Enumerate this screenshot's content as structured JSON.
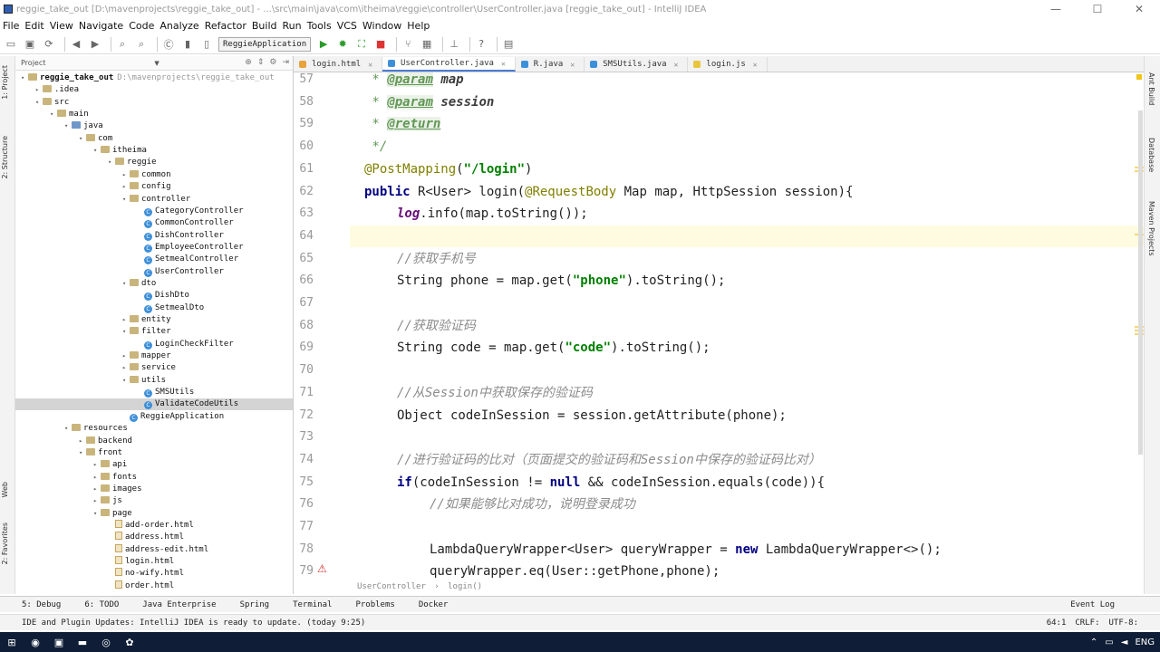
{
  "window": {
    "title": "reggie_take_out [D:\\mavenprojects\\reggie_take_out] - ...\\src\\main\\java\\com\\itheima\\reggie\\controller\\UserController.java [reggie_take_out] - IntelliJ IDEA"
  },
  "menu": [
    "File",
    "Edit",
    "View",
    "Navigate",
    "Code",
    "Analyze",
    "Refactor",
    "Build",
    "Run",
    "Tools",
    "VCS",
    "Window",
    "Help"
  ],
  "toolbar": {
    "run_config": "ReggieApplication"
  },
  "left_strip": {
    "project": "1: Project",
    "structure": "2: Structure",
    "web": "Web",
    "favorites": "2: Favorites"
  },
  "project": {
    "header": "Project",
    "tree": [
      {
        "label": "reggie_take_out",
        "path": "D:\\mavenprojects\\reggie_take_out",
        "indent": 0,
        "type": "folder",
        "tw": "▾"
      },
      {
        "label": ".idea",
        "indent": 1,
        "type": "folder",
        "tw": "▸"
      },
      {
        "label": "src",
        "indent": 1,
        "type": "folder",
        "tw": "▾"
      },
      {
        "label": "main",
        "indent": 2,
        "type": "folder",
        "tw": "▾"
      },
      {
        "label": "java",
        "indent": 3,
        "type": "src",
        "tw": "▾"
      },
      {
        "label": "com",
        "indent": 4,
        "type": "folder",
        "tw": "▾"
      },
      {
        "label": "itheima",
        "indent": 5,
        "type": "folder",
        "tw": "▾"
      },
      {
        "label": "reggie",
        "indent": 6,
        "type": "folder",
        "tw": "▾"
      },
      {
        "label": "common",
        "indent": 7,
        "type": "folder",
        "tw": "▸"
      },
      {
        "label": "config",
        "indent": 7,
        "type": "folder",
        "tw": "▸"
      },
      {
        "label": "controller",
        "indent": 7,
        "type": "folder",
        "tw": "▾"
      },
      {
        "label": "CategoryController",
        "indent": 8,
        "type": "cls",
        "tw": ""
      },
      {
        "label": "CommonController",
        "indent": 8,
        "type": "cls",
        "tw": ""
      },
      {
        "label": "DishController",
        "indent": 8,
        "type": "cls",
        "tw": ""
      },
      {
        "label": "EmployeeController",
        "indent": 8,
        "type": "cls",
        "tw": ""
      },
      {
        "label": "SetmealController",
        "indent": 8,
        "type": "cls",
        "tw": ""
      },
      {
        "label": "UserController",
        "indent": 8,
        "type": "cls",
        "tw": ""
      },
      {
        "label": "dto",
        "indent": 7,
        "type": "folder",
        "tw": "▾"
      },
      {
        "label": "DishDto",
        "indent": 8,
        "type": "cls",
        "tw": ""
      },
      {
        "label": "SetmealDto",
        "indent": 8,
        "type": "cls",
        "tw": ""
      },
      {
        "label": "entity",
        "indent": 7,
        "type": "folder",
        "tw": "▸"
      },
      {
        "label": "filter",
        "indent": 7,
        "type": "folder",
        "tw": "▾"
      },
      {
        "label": "LoginCheckFilter",
        "indent": 8,
        "type": "cls",
        "tw": ""
      },
      {
        "label": "mapper",
        "indent": 7,
        "type": "folder",
        "tw": "▸"
      },
      {
        "label": "service",
        "indent": 7,
        "type": "folder",
        "tw": "▸"
      },
      {
        "label": "utils",
        "indent": 7,
        "type": "folder",
        "tw": "▾"
      },
      {
        "label": "SMSUtils",
        "indent": 8,
        "type": "cls",
        "tw": ""
      },
      {
        "label": "ValidateCodeUtils",
        "indent": 8,
        "type": "cls",
        "tw": "",
        "selected": true
      },
      {
        "label": "ReggieApplication",
        "indent": 7,
        "type": "cls",
        "tw": ""
      },
      {
        "label": "resources",
        "indent": 3,
        "type": "folder",
        "tw": "▾"
      },
      {
        "label": "backend",
        "indent": 4,
        "type": "folder",
        "tw": "▸"
      },
      {
        "label": "front",
        "indent": 4,
        "type": "folder",
        "tw": "▾"
      },
      {
        "label": "api",
        "indent": 5,
        "type": "folder",
        "tw": "▸"
      },
      {
        "label": "fonts",
        "indent": 5,
        "type": "folder",
        "tw": "▸"
      },
      {
        "label": "images",
        "indent": 5,
        "type": "folder",
        "tw": "▸"
      },
      {
        "label": "js",
        "indent": 5,
        "type": "folder",
        "tw": "▸"
      },
      {
        "label": "page",
        "indent": 5,
        "type": "folder",
        "tw": "▾"
      },
      {
        "label": "add-order.html",
        "indent": 6,
        "type": "html",
        "tw": ""
      },
      {
        "label": "address.html",
        "indent": 6,
        "type": "html",
        "tw": ""
      },
      {
        "label": "address-edit.html",
        "indent": 6,
        "type": "html",
        "tw": ""
      },
      {
        "label": "login.html",
        "indent": 6,
        "type": "html",
        "tw": ""
      },
      {
        "label": "no-wify.html",
        "indent": 6,
        "type": "html",
        "tw": ""
      },
      {
        "label": "order.html",
        "indent": 6,
        "type": "html",
        "tw": ""
      }
    ]
  },
  "tabs": [
    {
      "label": "login.html",
      "color": "#e8a33c",
      "active": false
    },
    {
      "label": "UserController.java",
      "color": "#3d8fd8",
      "active": true
    },
    {
      "label": "R.java",
      "color": "#3d8fd8",
      "active": false
    },
    {
      "label": "SMSUtils.java",
      "color": "#3d8fd8",
      "active": false
    },
    {
      "label": "login.js",
      "color": "#e8c53c",
      "active": false
    }
  ],
  "code": {
    "line_numbers": [
      "57",
      "58",
      "59",
      "60",
      "61",
      "62",
      "63",
      "64",
      "65",
      "66",
      "67",
      "68",
      "69",
      "70",
      "71",
      "72",
      "73",
      "74",
      "75",
      "76",
      "77",
      "78",
      "79"
    ],
    "current_line": "64",
    "lines": [
      {
        "indent": 1,
        "html": "<span class=\"jd\"> * </span><span class=\"jt\">@param</span> <span class=\"jp\">map</span>"
      },
      {
        "indent": 1,
        "html": "<span class=\"jd\"> * </span><span class=\"jt\">@param</span> <span class=\"jp\">session</span>"
      },
      {
        "indent": 1,
        "html": "<span class=\"jd\"> * </span><span class=\"jt\">@return</span>"
      },
      {
        "indent": 1,
        "html": "<span class=\"jd\"> */</span>"
      },
      {
        "indent": 1,
        "html": "<span class=\"an\">@PostMapping</span>(<span class=\"st\">\"/login\"</span>)"
      },
      {
        "indent": 1,
        "html": "<span class=\"kw\">public</span> R&lt;User&gt; login(<span class=\"an\">@RequestBody</span> Map map, HttpSession session){"
      },
      {
        "indent": 2,
        "html": "<span class=\"sf\">log</span>.info(map.toString());"
      },
      {
        "indent": 2,
        "html": ""
      },
      {
        "indent": 2,
        "html": "<span class=\"cm\">//获取手机号</span>"
      },
      {
        "indent": 2,
        "html": "String phone = map.get(<span class=\"st\">\"phone\"</span>).toString();"
      },
      {
        "indent": 2,
        "html": ""
      },
      {
        "indent": 2,
        "html": "<span class=\"cm\">//获取验证码</span>"
      },
      {
        "indent": 2,
        "html": "String code = map.get(<span class=\"st\">\"code\"</span>).toString();"
      },
      {
        "indent": 2,
        "html": ""
      },
      {
        "indent": 2,
        "html": "<span class=\"cm\">//从Session中获取保存的验证码</span>"
      },
      {
        "indent": 2,
        "html": "Object codeInSession = session.getAttribute(phone);"
      },
      {
        "indent": 2,
        "html": ""
      },
      {
        "indent": 2,
        "html": "<span class=\"cm\">//进行验证码的比对（页面提交的验证码和Session中保存的验证码比对）</span>"
      },
      {
        "indent": 2,
        "html": "<span class=\"kw\">if</span>(codeInSession != <span class=\"kw\">null</span> &amp;&amp; codeInSession.equals(code)){"
      },
      {
        "indent": 3,
        "html": "<span class=\"cm\">//如果能够比对成功，说明登录成功</span>"
      },
      {
        "indent": 3,
        "html": ""
      },
      {
        "indent": 3,
        "html": "LambdaQueryWrapper&lt;User&gt; queryWrapper = <span class=\"kw\">new</span> LambdaQueryWrapper&lt;&gt;();"
      },
      {
        "indent": 3,
        "html": "queryWrapper.eq(User::getPhone,phone);"
      }
    ]
  },
  "breadcrumb": {
    "cls": "UserController",
    "method": "login()"
  },
  "right_strip": {
    "ant": "Ant Build",
    "db": "Database",
    "maven": "Maven Projects"
  },
  "bottom_tabs": [
    "5: Debug",
    "6: TODO",
    "Java Enterprise",
    "Spring",
    "Terminal",
    "Problems",
    "Docker"
  ],
  "event_log": "Event Log",
  "status": {
    "message": "IDE and Plugin Updates: IntelliJ IDEA is ready to update. (today 9:25)",
    "position": "64:1",
    "line_sep": "CRLF:",
    "encoding": "UTF-8:"
  },
  "taskbar": {
    "lang": "ENG"
  }
}
